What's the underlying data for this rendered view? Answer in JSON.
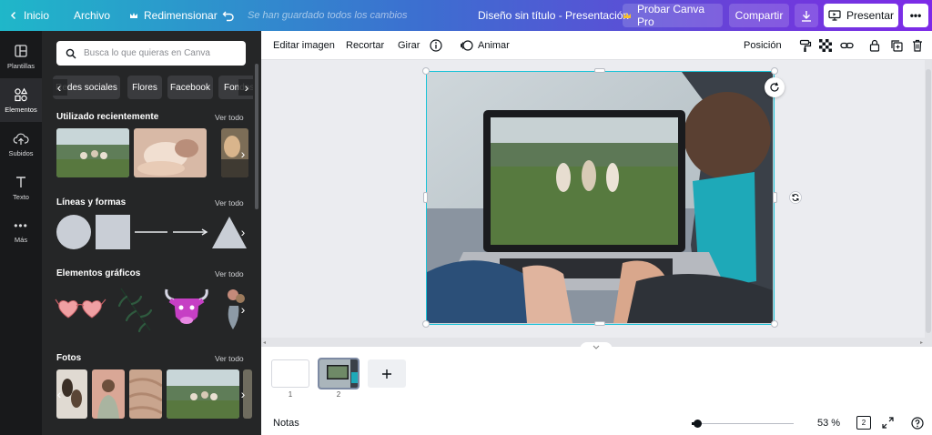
{
  "topbar": {
    "home": "Inicio",
    "file": "Archivo",
    "resize": "Redimensionar",
    "saved_status": "Se han guardado todos los cambios",
    "design_title": "Diseño sin título - Presentación",
    "try_pro": "Probar Canva Pro",
    "share": "Compartir",
    "present": "Presentar"
  },
  "rail": {
    "items": [
      {
        "label": "Plantillas",
        "icon": "layout-icon"
      },
      {
        "label": "Elementos",
        "icon": "shapes-icon"
      },
      {
        "label": "Subidos",
        "icon": "cloud-upload-icon"
      },
      {
        "label": "Texto",
        "icon": "text-icon"
      },
      {
        "label": "Más",
        "icon": "more-icon"
      }
    ]
  },
  "panel": {
    "search_placeholder": "Busca lo que quieras en Canva",
    "chips": [
      "Redes sociales",
      "Flores",
      "Facebook",
      "Fondos"
    ],
    "sections": {
      "recent": {
        "title": "Utilizado recientemente",
        "see_all": "Ver todo"
      },
      "shapes": {
        "title": "Líneas y formas",
        "see_all": "Ver todo"
      },
      "graphics": {
        "title": "Elementos gráficos",
        "see_all": "Ver todo"
      },
      "photos": {
        "title": "Fotos",
        "see_all": "Ver todo"
      }
    }
  },
  "toolbar": {
    "edit_image": "Editar imagen",
    "crop": "Recortar",
    "rotate": "Girar",
    "animate": "Animar",
    "position": "Posición"
  },
  "pages": {
    "numbers": [
      "1",
      "2"
    ],
    "add_icon": "plus-icon"
  },
  "statusbar": {
    "notes": "Notas",
    "zoom": "53 %",
    "zoom_fraction": 0.05,
    "page_count": "2"
  },
  "colors": {
    "accent_selection": "#19c3d8",
    "panel_bg": "#252627",
    "rail_bg": "#18191b",
    "pro_crown": "#f7c02b"
  }
}
